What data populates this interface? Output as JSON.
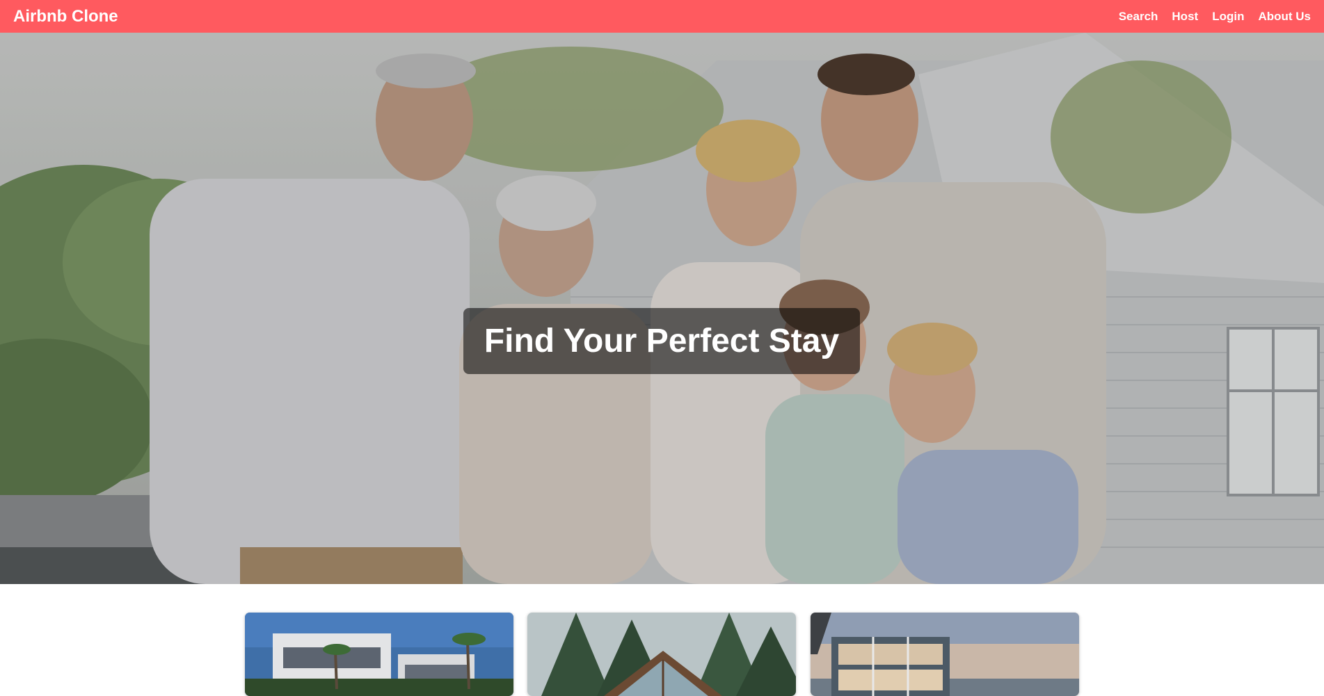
{
  "navbar": {
    "brand": "Airbnb Clone",
    "links": [
      "Search",
      "Host",
      "Login",
      "About Us"
    ],
    "background_color": "#ff5a5f"
  },
  "hero": {
    "title": "Find Your Perfect Stay",
    "image": "family-in-front-of-house-photo"
  },
  "listings": [
    {
      "image": "modern-villa-with-palm-trees-photo"
    },
    {
      "image": "a-frame-glass-cabin-in-forest-photo"
    },
    {
      "image": "glass-house-by-sea-at-sunset-photo"
    }
  ]
}
